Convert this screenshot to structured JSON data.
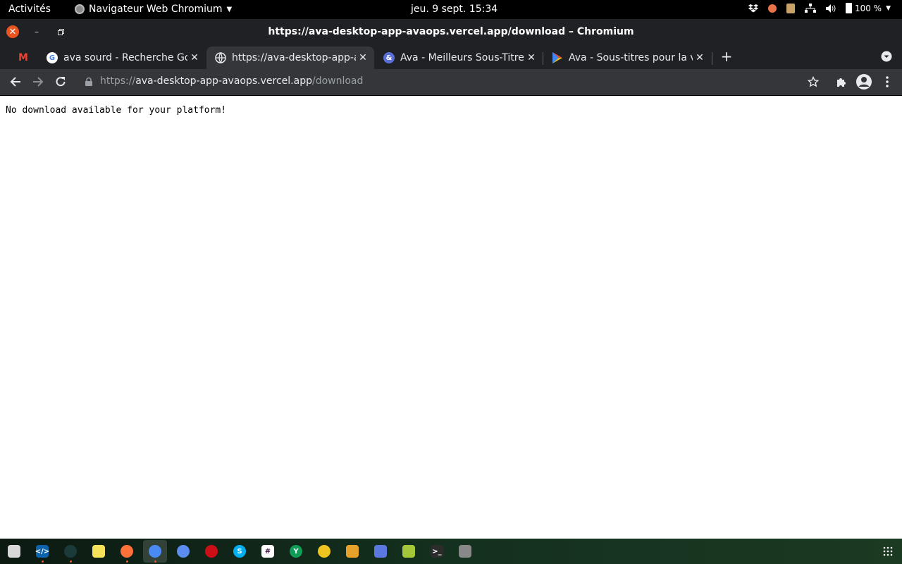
{
  "topbar": {
    "activities": "Activités",
    "app_name": "Navigateur Web Chromium",
    "clock": "jeu. 9 sept.  15:34",
    "battery": "100 %"
  },
  "window": {
    "title": "https://ava-desktop-app-avaops.vercel.app/download – Chromium"
  },
  "tabs": [
    {
      "label": "ava sourd - Recherche Goo"
    },
    {
      "label": "https://ava-desktop-app-avaops.vercel.app/download"
    },
    {
      "label": "Ava - Meilleurs Sous-Titres"
    },
    {
      "label": "Ava - Sous-titres pour la vie"
    }
  ],
  "address": {
    "scheme": "https://",
    "host": "ava-desktop-app-avaops.vercel.app",
    "path": "/download"
  },
  "page": {
    "message": "No download available for your platform!"
  },
  "colors": {
    "chrome_dark": "#202124",
    "toolbar": "#35363a",
    "close_button": "#e95420"
  }
}
